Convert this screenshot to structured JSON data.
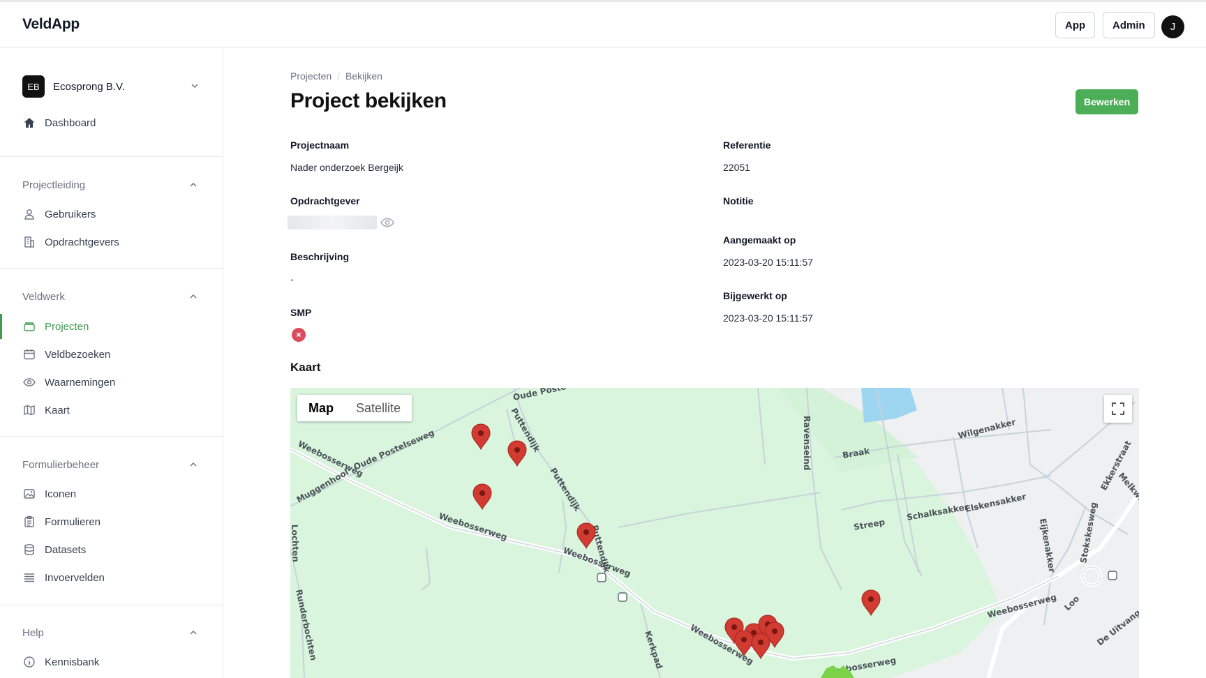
{
  "header": {
    "brand": "VeldApp",
    "app_label": "App",
    "admin_label": "Admin",
    "avatar_initial": "J"
  },
  "sidebar": {
    "org": {
      "badge": "EB",
      "name": "Ecosprong B.V."
    },
    "dashboard": "Dashboard",
    "sections": [
      {
        "title": "Projectleiding",
        "items": [
          "Gebruikers",
          "Opdrachtgevers"
        ]
      },
      {
        "title": "Veldwerk",
        "items": [
          "Projecten",
          "Veldbezoeken",
          "Waarnemingen",
          "Kaart"
        ]
      },
      {
        "title": "Formulierbeheer",
        "items": [
          "Iconen",
          "Formulieren",
          "Datasets",
          "Invoervelden"
        ]
      },
      {
        "title": "Help",
        "items": [
          "Kennisbank"
        ]
      }
    ],
    "active_item": "Projecten",
    "accent": "#3e9b4f"
  },
  "breadcrumb": [
    "Projecten",
    "Bekijken"
  ],
  "page_title": "Project bekijken",
  "edit_label": "Bewerken",
  "fields": {
    "projectnaam": {
      "label": "Projectnaam",
      "value": "Nader onderzoek Bergeijk"
    },
    "opdrachtgever": {
      "label": "Opdrachtgever"
    },
    "beschrijving": {
      "label": "Beschrijving",
      "value": "-"
    },
    "smp": {
      "label": "SMP"
    },
    "referentie": {
      "label": "Referentie",
      "value": "22051"
    },
    "notitie": {
      "label": "Notitie"
    },
    "aangemaakt": {
      "label": "Aangemaakt op",
      "value": "2023-03-20 15:11:57"
    },
    "bijgewerkt": {
      "label": "Bijgewerkt op",
      "value": "2023-03-20 15:11:57"
    }
  },
  "map": {
    "title": "Kaart",
    "toggle": [
      "Map",
      "Satellite"
    ],
    "selected": "Map",
    "streets": [
      "Oude Poste",
      "Puttendijk",
      "Weebosserweg",
      "Oude Postelseweg",
      "Muggenhool",
      "Puttendijk",
      "Puttendijk",
      "Weebosserweg",
      "Weebosserweg",
      "Ravenseind",
      "Wilgenakker",
      "Braak",
      "Ekkerstraat",
      "Melkweg",
      "Elskensakker",
      "Schalksakker",
      "Streep",
      "Eijkenakker",
      "Stokskesweg",
      "Runderbochten",
      "Kerkpad",
      "Weebosserweg",
      "Weebosserweg",
      "Weebosserweg",
      "Loo",
      "De Uitvang",
      "Lochten"
    ],
    "marker_color": "#d23b31"
  }
}
